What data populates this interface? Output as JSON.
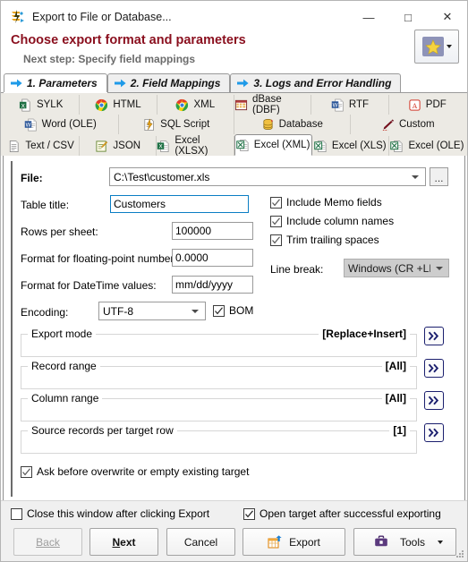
{
  "window": {
    "title": "Export to File or Database...",
    "icon": "export-app-icon",
    "controls": {
      "minimize": "—",
      "maximize": "□",
      "close": "✕"
    }
  },
  "header": {
    "title": "Choose export format and parameters",
    "subtitle": "Next step: Specify field mappings",
    "favorites_button": "favorites-star-button"
  },
  "step_tabs": [
    {
      "label": "1. Parameters",
      "active": true
    },
    {
      "label": "2. Field Mappings",
      "active": false
    },
    {
      "label": "3. Logs and Error Handling",
      "active": false
    }
  ],
  "format_tabs": {
    "row1": [
      {
        "label": "SYLK",
        "icon": "excel-sylk-icon"
      },
      {
        "label": "HTML",
        "icon": "chrome-icon"
      },
      {
        "label": "XML",
        "icon": "chrome-icon"
      },
      {
        "label": "dBase (DBF)",
        "icon": "dbase-table-icon"
      },
      {
        "label": "RTF",
        "icon": "word-doc-icon"
      },
      {
        "label": "PDF",
        "icon": "pdf-icon"
      }
    ],
    "row2": [
      {
        "label": "Word (OLE)",
        "icon": "word-doc-icon"
      },
      {
        "label": "SQL Script",
        "icon": "sql-script-icon"
      },
      {
        "label": "Database",
        "icon": "database-icon"
      },
      {
        "label": "Custom",
        "icon": "pencil-icon"
      }
    ],
    "row3": [
      {
        "label": "Text / CSV",
        "icon": "text-file-icon",
        "selected": false
      },
      {
        "label": "JSON",
        "icon": "json-notepad-icon",
        "selected": false
      },
      {
        "label": "Excel (XLSX)",
        "icon": "excel-xlsx-icon",
        "selected": false
      },
      {
        "label": "Excel (XML)",
        "icon": "excel-xml-icon",
        "selected": true
      },
      {
        "label": "Excel (XLS)",
        "icon": "excel-xls-icon",
        "selected": false
      },
      {
        "label": "Excel (OLE)",
        "icon": "excel-ole-icon",
        "selected": false
      }
    ]
  },
  "form": {
    "file_label": "File:",
    "file_value": "C:\\Test\\customer.xls",
    "browse_button": "...",
    "table_title_label": "Table title:",
    "table_title_value": "Customers",
    "rows_per_sheet_label": "Rows per sheet:",
    "rows_per_sheet_value": "100000",
    "float_format_label": "Format for floating-point numbers:",
    "float_format_value": "0.0000",
    "datetime_format_label": "Format for DateTime values:",
    "datetime_format_value": "mm/dd/yyyy",
    "encoding_label": "Encoding:",
    "encoding_value": "UTF-8",
    "bom_label": "BOM",
    "bom_checked": true,
    "include_memo_label": "Include Memo fields",
    "include_memo_checked": true,
    "include_columns_label": "Include column names",
    "include_columns_checked": true,
    "trim_spaces_label": "Trim trailing spaces",
    "trim_spaces_checked": true,
    "line_break_label": "Line break:",
    "line_break_value": "Windows (CR +LF)",
    "line_break_disabled": true
  },
  "groups": [
    {
      "caption": "Export mode",
      "value": "[Replace+Insert]",
      "expand": "»"
    },
    {
      "caption": "Record range",
      "value": "[All]",
      "expand": "»"
    },
    {
      "caption": "Column range",
      "value": "[All]",
      "expand": "»"
    },
    {
      "caption": "Source records per target row",
      "value": "[1]",
      "expand": "»"
    }
  ],
  "ask_overwrite": {
    "label": "Ask before overwrite or empty existing target",
    "checked": true
  },
  "footer": {
    "close_window_label": "Close this window after clicking Export",
    "close_window_checked": false,
    "open_target_label": "Open target after successful exporting",
    "open_target_checked": true,
    "buttons": {
      "back": "Back",
      "next_pre": "N",
      "next_post": "ext",
      "cancel": "Cancel",
      "export": "Export",
      "tools": "Tools"
    }
  },
  "colors": {
    "header_title": "#8a0f1e",
    "header_subtitle": "#6b6b6b",
    "tab_strip": "#eceae4",
    "footer_bg": "#f0f0f0",
    "focus_border": "#0b7ec4",
    "expand_button": "#1b1f6e"
  }
}
